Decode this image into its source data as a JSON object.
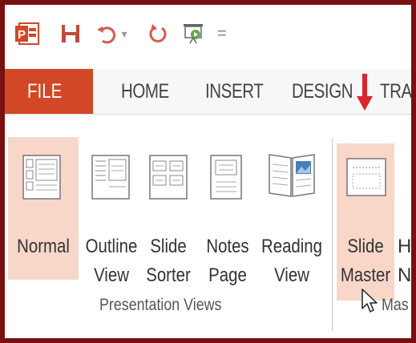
{
  "quick_access": {
    "app_icon": "powerpoint-logo-icon",
    "app_icon_letter": "P",
    "save_icon": "save-icon",
    "undo_icon": "undo-icon",
    "redo_icon": "redo-icon",
    "start_slideshow_icon": "slideshow-icon",
    "customize_icon": "customize-qat-icon",
    "undo_dropdown": "▾",
    "customize_label": "="
  },
  "tabs": {
    "file": "FILE",
    "home": "HOME",
    "insert": "INSERT",
    "design": "DESIGN",
    "transitions": "TRA"
  },
  "indicator": {
    "icon": "red-down-arrow-icon",
    "color": "#d9262c"
  },
  "presentation_views": {
    "group_label": "Presentation Views",
    "buttons": [
      {
        "line1": "Normal",
        "line2": "",
        "icon": "normal-view-icon"
      },
      {
        "line1": "Outline",
        "line2": "View",
        "icon": "outline-view-icon"
      },
      {
        "line1": "Slide",
        "line2": "Sorter",
        "icon": "slide-sorter-icon"
      },
      {
        "line1": "Notes",
        "line2": "Page",
        "icon": "notes-page-icon"
      },
      {
        "line1": "Reading",
        "line2": "View",
        "icon": "reading-view-icon"
      }
    ]
  },
  "master_views": {
    "group_label": "Mas",
    "buttons": [
      {
        "line1": "Slide",
        "line2": "Master",
        "icon": "slide-master-icon"
      },
      {
        "line1": "H",
        "line2": "N",
        "icon": "handout-master-icon"
      }
    ]
  },
  "colors": {
    "frame": "#7a0f12",
    "file_tab": "#d24726",
    "highlight": "#f8d7c9",
    "arrow": "#d9262c"
  }
}
